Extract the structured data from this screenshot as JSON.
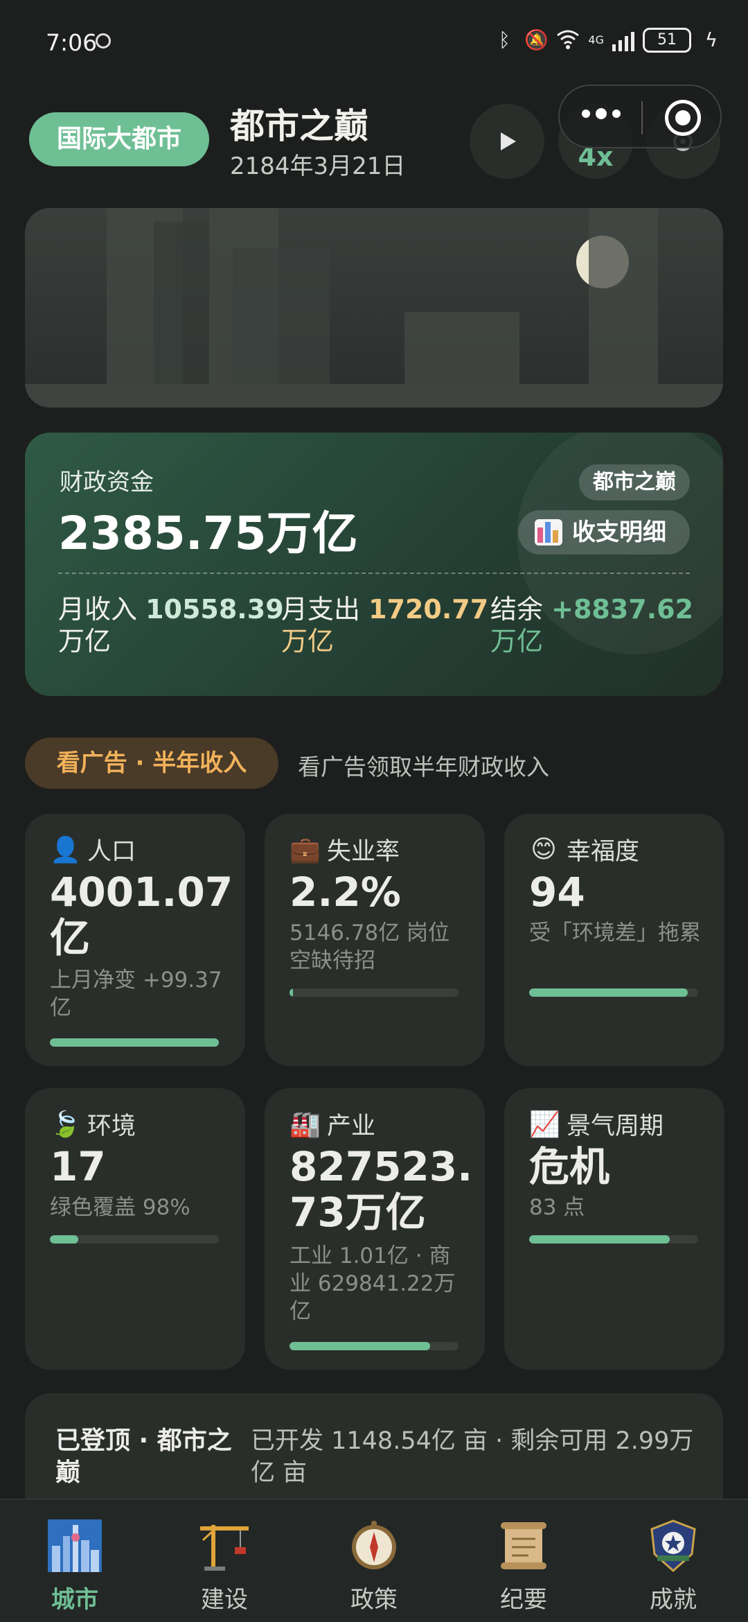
{
  "status_bar": {
    "time": "7:06",
    "network": "4G",
    "battery": "51"
  },
  "header": {
    "city_tag": "国际大都市",
    "title": "都市之巅",
    "date": "2184年3月21日",
    "play_icon": "play-icon",
    "speed": "4x",
    "settings_icon": "gear-icon"
  },
  "finance": {
    "label": "财政资金",
    "total": "2385.75万亿",
    "badge": "都市之巅",
    "detail_button": "收支明细",
    "income_label": "月收入",
    "income_value": "10558.39",
    "income_unit": "万亿",
    "expense_label": "月支出",
    "expense_value": "1720.77",
    "expense_unit": "万亿",
    "balance_label": "结余",
    "balance_value": "+8837.62",
    "balance_unit": "万亿"
  },
  "ad": {
    "tag": "看广告 · 半年收入",
    "desc": "看广告领取半年财政收入"
  },
  "stats": {
    "population": {
      "emoji": "👤",
      "label": "人口",
      "value": "4001.07亿",
      "sub": "上月净变 +99.37亿",
      "progress": 1.0
    },
    "unemployment": {
      "emoji": "💼",
      "label": "失业率",
      "value": "2.2%",
      "sub": "5146.78亿 岗位空缺待招",
      "progress": 0.022
    },
    "happiness": {
      "emoji": "😊",
      "label": "幸福度",
      "value": "94",
      "sub": "受「环境差」拖累",
      "progress": 0.94
    },
    "environment": {
      "emoji": "🍃",
      "label": "环境",
      "value": "17",
      "sub": "绿色覆盖 98%",
      "progress": 0.17
    },
    "industry": {
      "emoji": "🏭",
      "label": "产业",
      "value": "827523.73万亿",
      "sub": "工业 1.01亿 · 商业 629841.22万亿",
      "progress": 0.83
    },
    "cycle": {
      "emoji": "📈",
      "label": "景气周期",
      "value": "危机",
      "sub": "83 点",
      "progress": 0.83
    }
  },
  "summit": {
    "title": "已登顶 · 都市之巅",
    "desc": "已开发 1148.54亿 亩 · 剩余可用 2.99万亿 亩"
  },
  "tabs": [
    {
      "label": "城市",
      "icon": "city-icon"
    },
    {
      "label": "建设",
      "icon": "crane-icon"
    },
    {
      "label": "政策",
      "icon": "compass-icon"
    },
    {
      "label": "纪要",
      "icon": "scroll-icon"
    },
    {
      "label": "成就",
      "icon": "badge-icon"
    }
  ],
  "colors": {
    "accent": "#6fbf95",
    "expense": "#f2cb85",
    "ad": "#f2b25b",
    "background": "#1c1f1d"
  }
}
